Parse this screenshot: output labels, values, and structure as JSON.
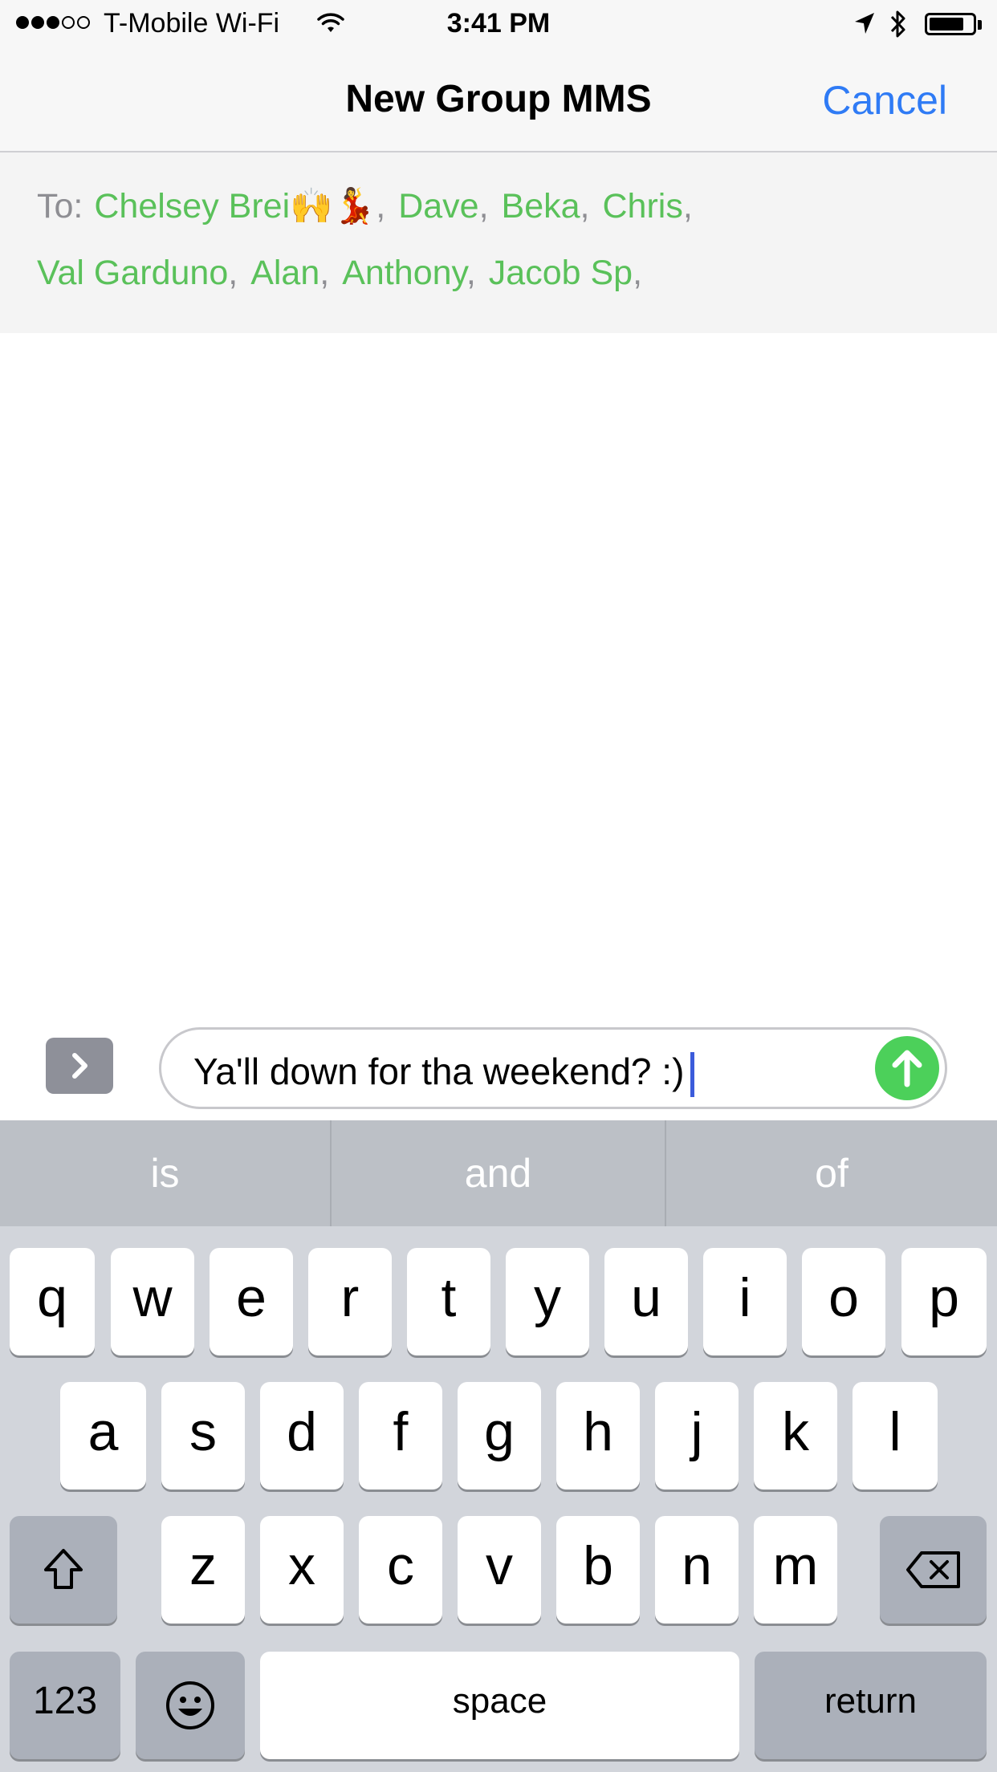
{
  "status_bar": {
    "signal_bars": [
      true,
      true,
      true,
      false,
      false
    ],
    "carrier": "T-Mobile Wi-Fi",
    "time": "3:41 PM",
    "battery_level": 0.8
  },
  "nav": {
    "title": "New Group MMS",
    "cancel_label": "Cancel"
  },
  "recipients": {
    "to_label": "To:",
    "line1": [
      "Chelsey Brei🙌💃",
      "Dave",
      "Beka",
      "Chris"
    ],
    "line2": [
      "Val Garduno",
      "Alan",
      "Anthony",
      "Jacob Sp"
    ]
  },
  "compose": {
    "message": "Ya'll down for tha weekend? :)"
  },
  "keyboard": {
    "suggestions": [
      "is",
      "and",
      "of"
    ],
    "row1": [
      "q",
      "w",
      "e",
      "r",
      "t",
      "y",
      "u",
      "i",
      "o",
      "p"
    ],
    "row2": [
      "a",
      "s",
      "d",
      "f",
      "g",
      "h",
      "j",
      "k",
      "l"
    ],
    "row3": [
      "z",
      "x",
      "c",
      "v",
      "b",
      "n",
      "m"
    ],
    "numbers_label": "123",
    "space_label": "space",
    "return_label": "return"
  },
  "colors": {
    "accent_blue": "#2f7bf5",
    "recipient_green": "#5ac15a",
    "send_green": "#4cd05a"
  },
  "icons": [
    "wifi-icon",
    "location-arrow-icon",
    "bluetooth-icon",
    "battery-icon",
    "chevron-right-icon",
    "arrow-up-icon",
    "shift-icon",
    "backspace-icon",
    "emoji-icon"
  ]
}
